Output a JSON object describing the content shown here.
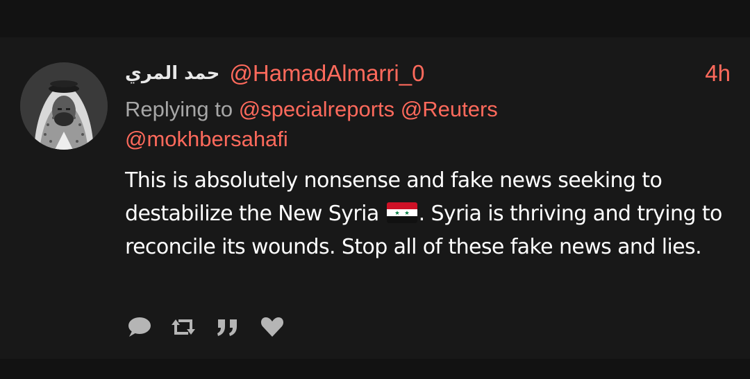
{
  "tweet": {
    "display_name": "حمد المري",
    "handle": "@HamadAlmarri_0",
    "time": "4h",
    "replying_prefix": "Replying to",
    "mentions": [
      "@specialreports",
      "@Reuters",
      "@mokhbersahafi"
    ],
    "text_part1": "This is absolutely nonsense and fake news seeking to destabilize the New Syria",
    "text_part2": ". Syria is thriving and trying to reconcile its wounds. Stop all of these fake news and lies.",
    "flag_icon": "syria-flag-icon"
  },
  "actions": [
    {
      "name": "reply",
      "icon": "comment-bubble-icon"
    },
    {
      "name": "retweet",
      "icon": "retweet-icon"
    },
    {
      "name": "quote",
      "icon": "quote-icon"
    },
    {
      "name": "like",
      "icon": "heart-icon"
    }
  ],
  "colors": {
    "background": "#181818",
    "bar": "#121212",
    "accent": "#ff6a5c",
    "secondary_text": "#a7a7a7",
    "text": "#ffffff",
    "action_icon": "#b5b5b5"
  }
}
